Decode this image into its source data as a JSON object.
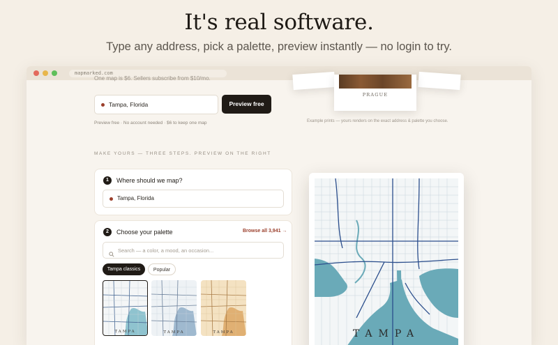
{
  "hero": {
    "headline": "It's real software.",
    "subline": "Type any address, pick a palette, preview instantly — no login to try."
  },
  "browser": {
    "url": "mapmarked.com",
    "dots": [
      "#e36a5d",
      "#e8b64a",
      "#5fbf5b"
    ]
  },
  "top_form": {
    "cutoff_text": "One map is $6. Sellers subscribe from $10/mo.",
    "address_value": "Tampa, Florida",
    "preview_button": "Preview free",
    "note": "Preview free · No account needed · $6 to keep one map"
  },
  "examples": {
    "print_label": "PRAGUE",
    "caption": "Example prints — yours renders on the exact address & palette you choose."
  },
  "section_label": "MAKE YOURS — THREE STEPS. PREVIEW ON THE RIGHT",
  "step1": {
    "number": "1",
    "title": "Where should we map?",
    "address_value": "Tampa, Florida"
  },
  "step2": {
    "number": "2",
    "title": "Choose your palette",
    "browse_link": "Browse all 3,941 →",
    "search_placeholder": "Search — a color, a mood, an occasion...",
    "chips": [
      "Tampa classics",
      "Popular"
    ],
    "thumbs": [
      {
        "label": "TAMPA",
        "water": "#8fc3cf",
        "bg": "#f4f6f7",
        "road": "#4a6a95"
      },
      {
        "label": "TAMPA",
        "water": "#9fb9cf",
        "bg": "#eef2f5",
        "road": "#6a7f99"
      },
      {
        "label": "TAMPA",
        "water": "#e0b073",
        "bg": "#f4e2c2",
        "road": "#a97c47"
      }
    ]
  },
  "poster": {
    "title": "TAMPA",
    "colors": {
      "water": "#6aaab8",
      "land": "#f3f6f7",
      "road": "#2b4e8c",
      "minor": "#c9d3dc"
    }
  },
  "colors": {
    "page_bg": "#f5efe6",
    "accent": "#9b3f2c",
    "button_dark": "#201b16"
  }
}
